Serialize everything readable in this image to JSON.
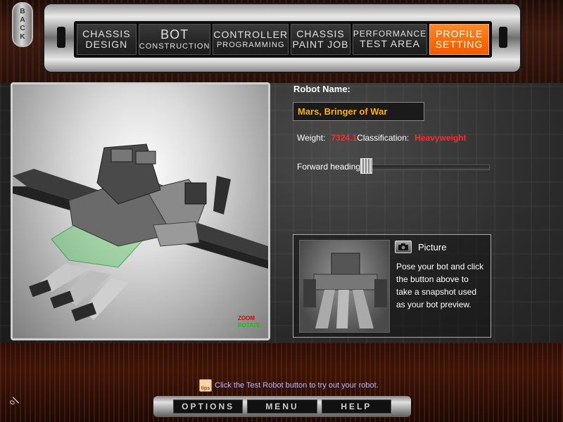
{
  "nav": {
    "back_label": "BACK",
    "tabs": [
      {
        "line1": "CHASSIS",
        "line2": "DESIGN"
      },
      {
        "line1": "BOT",
        "line2": "CONSTRUCTION"
      },
      {
        "line1": "CONTROLLER",
        "line2": "PROGRAMMING"
      },
      {
        "line1": "CHASSIS",
        "line2": "PAINT JOB"
      },
      {
        "line1": "PERFORMANCE",
        "line2": "TEST AREA"
      },
      {
        "line1": "PROFILE",
        "line2": "SETTING"
      }
    ],
    "active_color": "#ff6a00"
  },
  "viewport": {
    "zoom_label": "ZOOM",
    "rotate_label": "ROTATE"
  },
  "profile": {
    "name_label": "Robot Name:",
    "name_value": "Mars, Bringer of War",
    "weight_label": "Weight:",
    "weight_value": "7324.1",
    "class_label": "Classification:",
    "class_value": "Heavyweight",
    "heading_label": "Forward heading:"
  },
  "picture": {
    "title": "Picture",
    "description": "Pose your bot and click the button above to take a snapshot used as your bot preview."
  },
  "footer": {
    "tip_icon_label": "tips",
    "tip_text": "Click the Test Robot button to try out your robot.",
    "buttons": [
      "OPTIONS",
      "MENU",
      "HELP"
    ]
  }
}
